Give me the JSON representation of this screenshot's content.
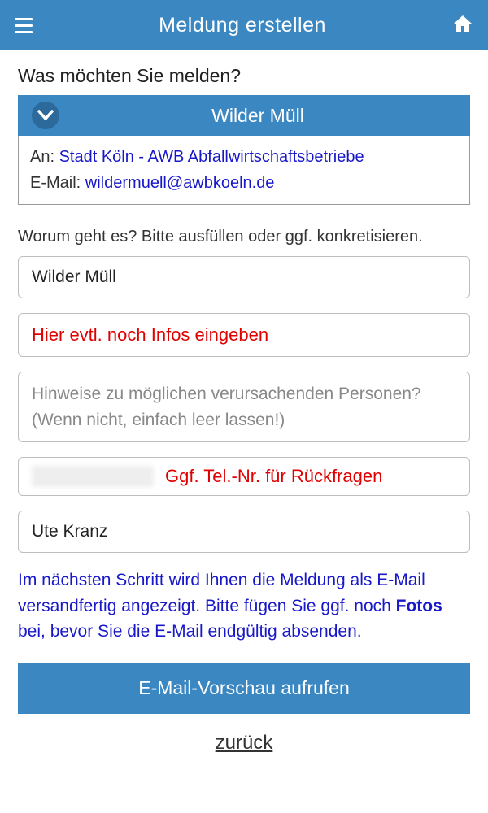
{
  "header": {
    "title": "Meldung erstellen"
  },
  "question1": "Was möchten Sie melden?",
  "dropdown": {
    "selected": "Wilder Müll"
  },
  "recipient": {
    "an_label": "An: ",
    "an_value": "Stadt Köln - AWB Abfallwirtschaftsbetriebe",
    "email_label": "E-Mail: ",
    "email_value": "wildermuell@awbkoeln.de"
  },
  "question2": "Worum geht es? Bitte ausfüllen oder ggf. konkretisieren.",
  "fields": {
    "subject": "Wilder Müll",
    "info_hint": "Hier evtl. noch Infos eingeben",
    "persons_placeholder": "Hinweise zu möglichen verursachenden Personen? (Wenn nicht, einfach leer lassen!)",
    "phone_hint": "Ggf. Tel.-Nr. für Rückfragen",
    "name": "Ute Kranz"
  },
  "info_text": {
    "part1": "Im nächsten Schritt wird Ihnen die Meldung als E-Mail versandfertig angezeigt. Bitte fügen Sie ggf. noch ",
    "bold": "Fotos",
    "part2": " bei, bevor Sie die E-Mail endgültig absenden."
  },
  "primary_button": "E-Mail-Vorschau aufrufen",
  "back_link": "zurück"
}
